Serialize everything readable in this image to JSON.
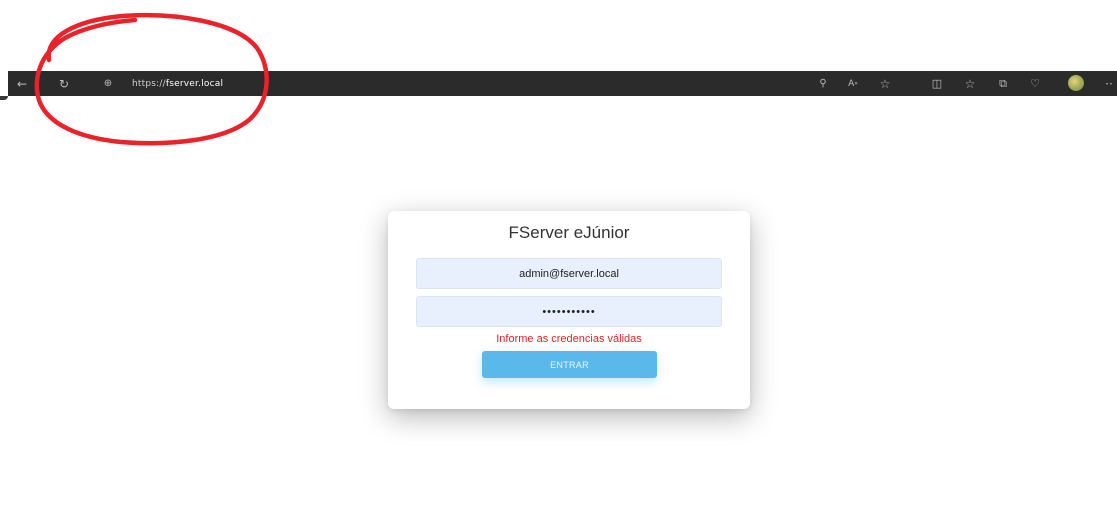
{
  "browser": {
    "url_scheme": "https://",
    "url_host": "fserver.local",
    "icons": {
      "back": "arrow-left-icon",
      "reload": "reload-icon",
      "site_info": "lock-icon",
      "zoom": "key-icon",
      "read_aloud": "read-aloud-icon",
      "favorite": "star-icon",
      "split_screen": "split-screen-icon",
      "favorites": "favorites-icon",
      "collections": "collections-icon",
      "heart": "heart-icon",
      "profile": "avatar",
      "more": "more-icon"
    }
  },
  "login": {
    "title": "FServer eJúnior",
    "email_value": "admin@fserver.local",
    "password_value": "•••••••••••",
    "error_message": "Informe as credencias válidas",
    "submit_label": "ENTRAR"
  },
  "colors": {
    "toolbar_bg": "#2b2b2b",
    "field_bg": "#e8f0fe",
    "error": "#e0242a",
    "button_bg": "#5bb8ea",
    "annotation": "#e8232a"
  }
}
